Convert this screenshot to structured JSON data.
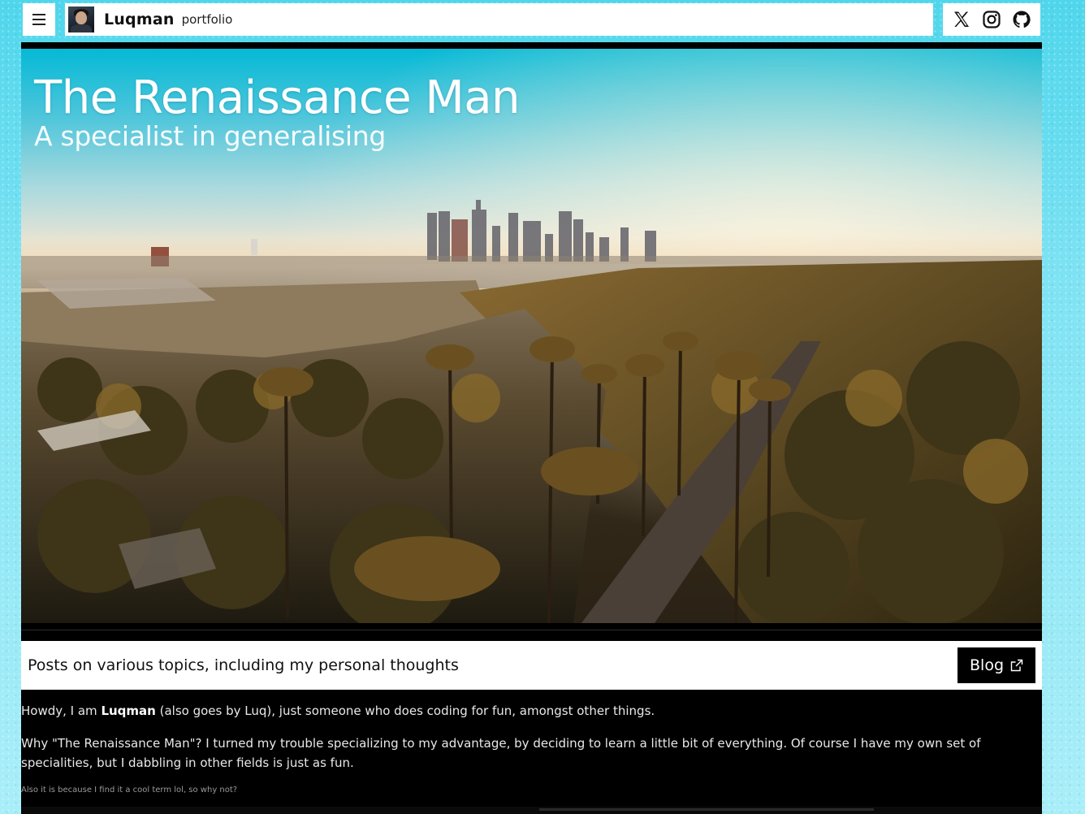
{
  "header": {
    "brand_name": "Luqman",
    "brand_subtitle": "portfolio",
    "menu_icon": "hamburger-menu-icon",
    "social": [
      {
        "icon": "x-twitter-icon"
      },
      {
        "icon": "instagram-icon"
      },
      {
        "icon": "github-icon"
      }
    ]
  },
  "hero": {
    "title": "The Renaissance Man",
    "subtitle": "A specialist in generalising"
  },
  "blog_banner": {
    "text": "Posts on various topics, including my personal thoughts",
    "button_label": "Blog",
    "button_icon": "external-link-icon"
  },
  "intro": {
    "p1_before": "Howdy, I am ",
    "p1_name": "Luqman",
    "p1_after": " (also goes by Luq), just someone who does coding for fun, amongst other things.",
    "p2": "Why \"The Renaissance Man\"? I turned my trouble specializing to my advantage, by deciding to learn a little bit of everything. Of course I have my own set of specialities, but I dabbling in other fields is just as fun.",
    "p3": "Also it is because I find it a cool term lol, so why not?"
  },
  "colors": {
    "backdrop": "#4fd6ec",
    "panel": "#000000",
    "bar": "#ffffff"
  }
}
